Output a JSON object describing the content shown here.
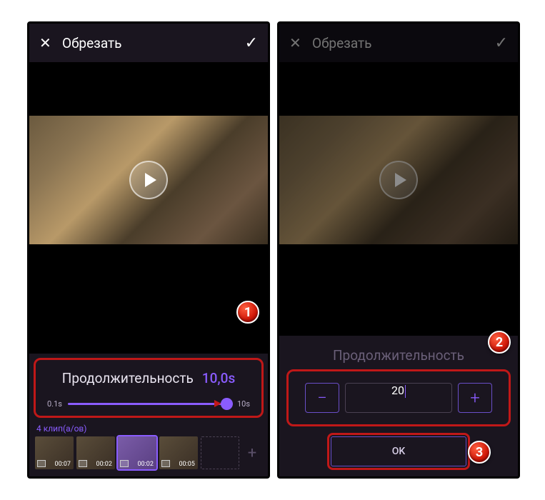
{
  "left": {
    "header": {
      "title": "Обрезать"
    },
    "duration": {
      "label": "Продолжительность",
      "value": "10,0s",
      "min_label": "0.1s",
      "max_label": "10s"
    },
    "clips": {
      "count_label": "4 клип(а/ов)",
      "items": [
        {
          "time": "00:07"
        },
        {
          "time": "00:02"
        },
        {
          "time": "00:02"
        },
        {
          "time": "00:05"
        }
      ]
    },
    "marker": "1"
  },
  "right": {
    "header": {
      "title": "Обрезать"
    },
    "duration_dim_label": "Продолжительность",
    "stepper": {
      "value": "20"
    },
    "ok_label": "OK",
    "marker_stepper": "2",
    "marker_ok": "3"
  }
}
